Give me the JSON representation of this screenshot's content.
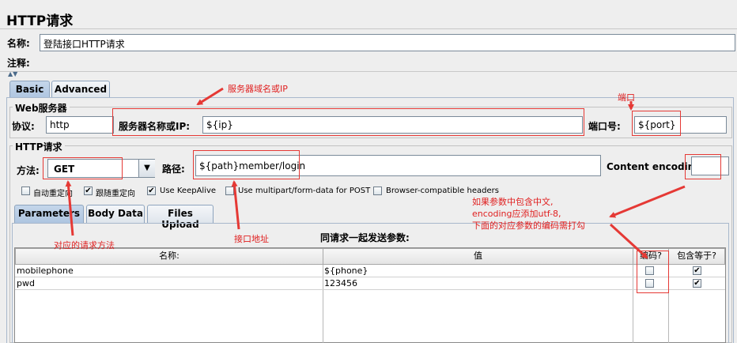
{
  "panel": {
    "title": "HTTP请求"
  },
  "name_row": {
    "label": "名称:",
    "value": "登陆接口HTTP请求"
  },
  "comment_row": {
    "label": "注释:",
    "value": ""
  },
  "config_tabs": [
    {
      "label": "Basic",
      "active": true
    },
    {
      "label": "Advanced",
      "active": false
    }
  ],
  "web_server": {
    "title": "Web服务器",
    "protocol_label": "协议:",
    "protocol_value": "http",
    "server_label": "服务器名称或IP:",
    "server_value": "${ip}",
    "port_label": "端口号:",
    "port_value": "${port}"
  },
  "http_request": {
    "title": "HTTP请求",
    "method_label": "方法:",
    "method_value": "GET",
    "path_label": "路径:",
    "path_value": "${path}member/login",
    "encoding_label": "Content encoding:",
    "encoding_value": ""
  },
  "options": [
    {
      "label": "自动重定向",
      "checked": false
    },
    {
      "label": "跟随重定向",
      "checked": true
    },
    {
      "label": "Use KeepAlive",
      "checked": true
    },
    {
      "label": "Use multipart/form-data for POST",
      "checked": false
    },
    {
      "label": "Browser-compatible headers",
      "checked": false
    }
  ],
  "param_tabs": [
    {
      "label": "Parameters",
      "active": true
    },
    {
      "label": "Body Data",
      "active": false
    },
    {
      "label": "Files Upload",
      "active": false
    }
  ],
  "params": {
    "heading": "同请求一起发送参数:",
    "columns": [
      "名称:",
      "值",
      "编码?",
      "包含等于?"
    ],
    "rows": [
      {
        "name": "mobilephone",
        "value": "${phone}",
        "encode": false,
        "include_equals": true
      },
      {
        "name": "pwd",
        "value": "123456",
        "encode": false,
        "include_equals": true
      }
    ]
  },
  "annotations": {
    "server": "服务器域名或IP",
    "port": "端口",
    "method": "对应的请求方法",
    "path": "接口地址",
    "encoding_line1": "如果参数中包含中文,",
    "encoding_line2": "encoding应添加utf-8,",
    "encoding_line3": "下面的对应参数的编码需打勾"
  },
  "colors": {
    "annotation": "#e53935",
    "tab_active": "#b8cce4"
  }
}
